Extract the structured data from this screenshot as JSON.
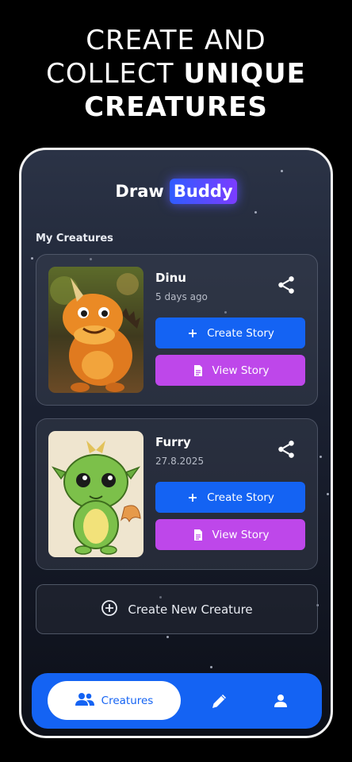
{
  "promo": {
    "line1": "CREATE AND",
    "line2_regular": "COLLECT ",
    "line2_bold": "UNIQUE",
    "line3": "CREATURES"
  },
  "app": {
    "logo_draw": "Draw",
    "logo_buddy": "Buddy",
    "section_title": "My Creatures"
  },
  "creatures": [
    {
      "name": "Dinu",
      "date": "5 days ago",
      "create_label": "Create Story",
      "view_label": "View Story",
      "image": "orange-horned-dinosaur-image"
    },
    {
      "name": "Furry",
      "date": "27.8.2025",
      "create_label": "Create Story",
      "view_label": "View Story",
      "image": "green-baby-dragon-drawing"
    }
  ],
  "new_creature_label": "Create New Creature",
  "nav": {
    "items": [
      {
        "label": "Creatures",
        "icon": "people-icon",
        "active": true
      },
      {
        "label": "",
        "icon": "pencil-icon",
        "active": false
      },
      {
        "label": "",
        "icon": "person-icon",
        "active": false
      }
    ]
  },
  "colors": {
    "primary_blue": "#1463f3",
    "view_purple": "#be47ea",
    "background_dark": "#1a2030"
  }
}
